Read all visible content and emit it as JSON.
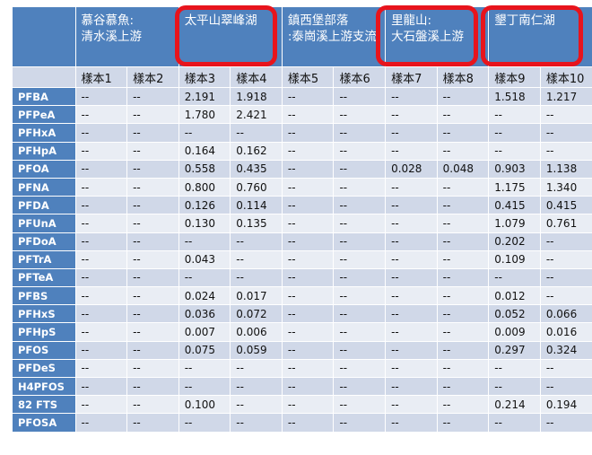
{
  "table": {
    "header": [
      "",
      "慕谷慕魚:清水溪上游",
      "太平山翠峰湖",
      "鎮西堡部落:泰崗溪上游支流",
      "里龍山:大石盤溪上游",
      "墾丁南仁湖"
    ],
    "samples": [
      "樣本1",
      "樣本2",
      "樣本3",
      "樣本4",
      "樣本5",
      "樣本6",
      "樣本7",
      "樣本8",
      "樣本9",
      "樣本10"
    ],
    "rows": [
      {
        "name": "PFBA",
        "values": [
          "--",
          "--",
          "2.191",
          "1.918",
          "--",
          "--",
          "--",
          "--",
          "1.518",
          "1.217"
        ]
      },
      {
        "name": "PFPeA",
        "values": [
          "--",
          "--",
          "1.780",
          "2.421",
          "--",
          "--",
          "--",
          "--",
          "--",
          "--"
        ]
      },
      {
        "name": "PFHxA",
        "values": [
          "--",
          "--",
          "--",
          "--",
          "--",
          "--",
          "--",
          "--",
          "--",
          "--"
        ]
      },
      {
        "name": "PFHpA",
        "values": [
          "--",
          "--",
          "0.164",
          "0.162",
          "--",
          "--",
          "--",
          "--",
          "--",
          "--"
        ]
      },
      {
        "name": "PFOA",
        "values": [
          "--",
          "--",
          "0.558",
          "0.435",
          "--",
          "--",
          "0.028",
          "0.048",
          "0.903",
          "1.138"
        ]
      },
      {
        "name": "PFNA",
        "values": [
          "--",
          "--",
          "0.800",
          "0.760",
          "--",
          "--",
          "--",
          "--",
          "1.175",
          "1.340"
        ]
      },
      {
        "name": "PFDA",
        "values": [
          "--",
          "--",
          "0.126",
          "0.114",
          "--",
          "--",
          "--",
          "--",
          "0.415",
          "0.415"
        ]
      },
      {
        "name": "PFUnA",
        "values": [
          "--",
          "--",
          "0.130",
          "0.135",
          "--",
          "--",
          "--",
          "--",
          "1.079",
          "0.761"
        ]
      },
      {
        "name": "PFDoA",
        "values": [
          "--",
          "--",
          "--",
          "--",
          "--",
          "--",
          "--",
          "--",
          "0.202",
          "--"
        ]
      },
      {
        "name": "PFTrA",
        "values": [
          "--",
          "--",
          "0.043",
          "--",
          "--",
          "--",
          "--",
          "--",
          "0.109",
          "--"
        ]
      },
      {
        "name": "PFTeA",
        "values": [
          "--",
          "--",
          "--",
          "--",
          "--",
          "--",
          "--",
          "--",
          "--",
          "--"
        ]
      },
      {
        "name": "PFBS",
        "values": [
          "--",
          "--",
          "0.024",
          "0.017",
          "--",
          "--",
          "--",
          "--",
          "0.012",
          "--"
        ]
      },
      {
        "name": "PFHxS",
        "values": [
          "--",
          "--",
          "0.036",
          "0.072",
          "--",
          "--",
          "--",
          "--",
          "0.052",
          "0.066"
        ]
      },
      {
        "name": "PFHpS",
        "values": [
          "--",
          "--",
          "0.007",
          "0.006",
          "--",
          "--",
          "--",
          "--",
          "0.009",
          "0.016"
        ]
      },
      {
        "name": "PFOS",
        "values": [
          "--",
          "--",
          "0.075",
          "0.059",
          "--",
          "--",
          "--",
          "--",
          "0.297",
          "0.324"
        ]
      },
      {
        "name": "PFDeS",
        "values": [
          "--",
          "--",
          "--",
          "--",
          "--",
          "--",
          "--",
          "--",
          "--",
          "--"
        ]
      },
      {
        "name": "H4PFOS",
        "values": [
          "--",
          "--",
          "--",
          "--",
          "--",
          "--",
          "--",
          "--",
          "--",
          "--"
        ]
      },
      {
        "name": "82 FTS",
        "values": [
          "--",
          "--",
          "0.100",
          "--",
          "--",
          "--",
          "--",
          "--",
          "0.214",
          "0.194"
        ]
      },
      {
        "name": "PFOSA",
        "values": [
          "--",
          "--",
          "--",
          "--",
          "--",
          "--",
          "--",
          "--",
          "--",
          "--"
        ]
      }
    ]
  },
  "highlight_color": "#e8141c",
  "colors": {
    "header_blue": "#4f81bd",
    "row_light": "#e9edf4",
    "row_dark": "#d0d8e8"
  }
}
